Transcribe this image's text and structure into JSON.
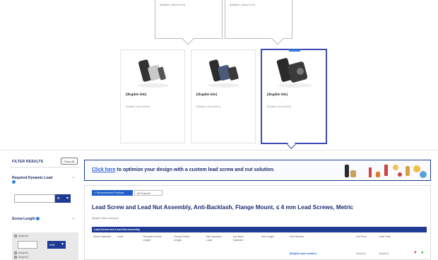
{
  "callouts": [
    {
      "text": "[illegible callout text]"
    },
    {
      "text": "[illegible callout text]"
    }
  ],
  "products": [
    {
      "title": "[illegible title]",
      "desc": "[illegible description]"
    },
    {
      "title": "[illegible title]",
      "desc": "[illegible description]"
    },
    {
      "title": "[illegible title]",
      "desc": "[illegible description]"
    }
  ],
  "sidebar": {
    "title": "FILTER RESULTS",
    "clear_label": "Clear All",
    "required_label": "Required Dynamic Load",
    "screw_length_label": "Screw Length",
    "unit_1": "lb",
    "unit_2": "mm",
    "radio_1": "[illegible]",
    "radio_2": "[illegible]",
    "radio_3": "[illegible]"
  },
  "banner": {
    "link_text": "Click here",
    "text": " to optimize your design with a custom lead screw and nut solution."
  },
  "results": {
    "tab_recommended": "✔ Recommended Products",
    "tab_all": "All Products",
    "title": "Lead Screw and Lead Nut Assembly, Anti-Backlash, Flange Mount, ≤ 4 mm Lead Screws, Metric",
    "meta": "[illegible filter summary]",
    "group_header": "Lead Screw and Lead Nut Assembly",
    "columns": [
      "Screw Diameter",
      "Lead",
      "Threaded Screw Length",
      "Overall Screw Length",
      "Max Dynamic Load",
      "Nut Base Diameter",
      "Nut Length",
      "Part Number",
      "List Price",
      "Lead Time"
    ],
    "row": {
      "part_number": "[illegible part number]",
      "price": "[illegible]",
      "lead_time": "[illegible]"
    }
  },
  "colors": {
    "brand_navy": "#1c2c6e",
    "accent_blue": "#2962d9",
    "header_blue": "#1f3a93"
  }
}
